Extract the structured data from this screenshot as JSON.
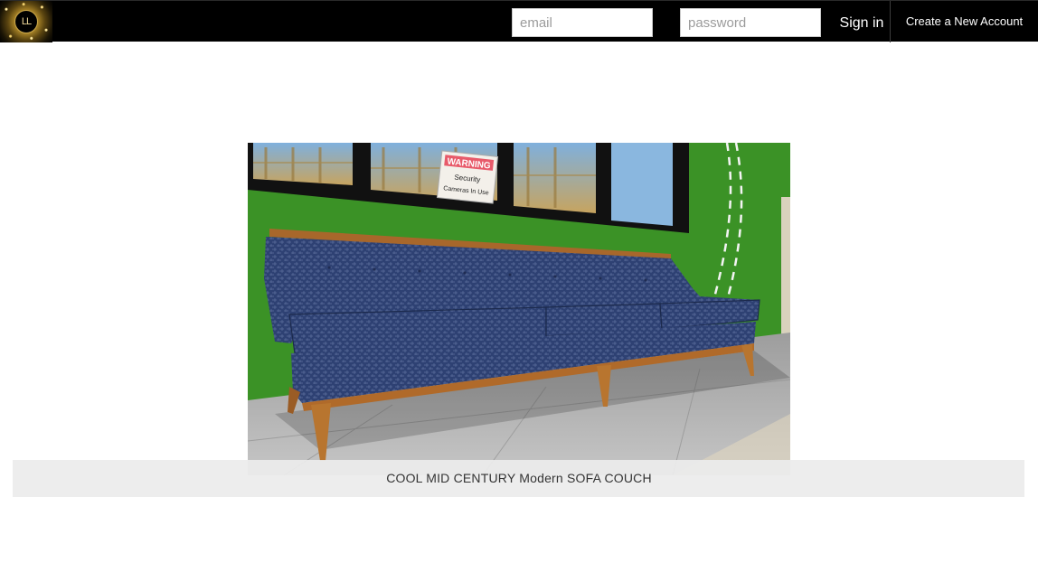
{
  "header": {
    "logo_text": "LL",
    "email_placeholder": "email",
    "password_placeholder": "password",
    "sign_in_label": "Sign in",
    "create_account_label": "Create a New Account"
  },
  "main": {
    "sign_text": "WARNING",
    "sign_subtext_line1": "Security",
    "sign_subtext_line2": "Cameras In Use",
    "caption": "COOL MID CENTURY Modern SOFA COUCH"
  },
  "colors": {
    "header_bg": "#000000",
    "caption_strip": "#ececec",
    "wall_green": "#3f9a2a",
    "sofa_blue": "#2c3e6e",
    "wood": "#b06a2a"
  }
}
